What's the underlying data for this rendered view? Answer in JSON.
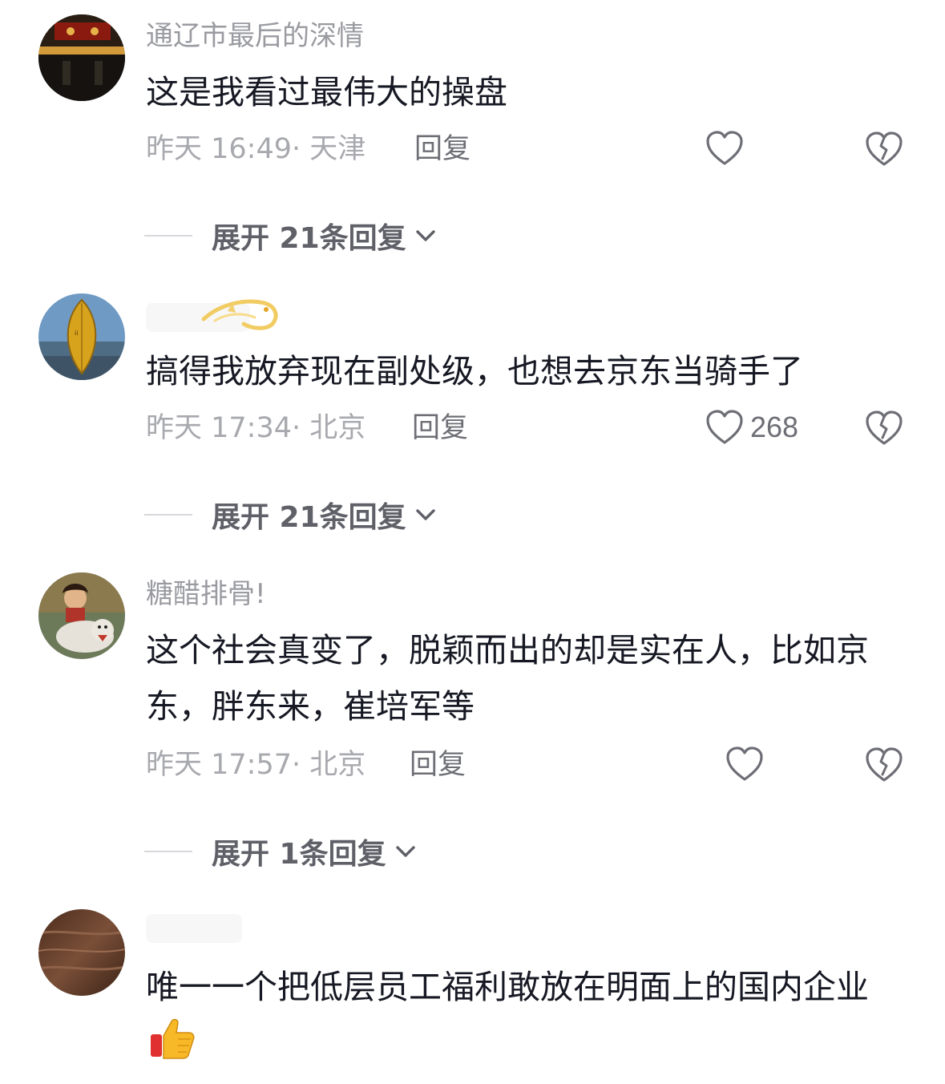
{
  "comments": [
    {
      "username": "通辽市最后的深情",
      "text": "这是我看过最伟大的操盘",
      "time": "昨天 16:49",
      "location": "天津",
      "reply_label": "回复",
      "like_count": "",
      "expand_label": "展开 21条回复",
      "avatar_icon": "storefront-night-avatar"
    },
    {
      "username": "",
      "text": "搞得我放弃现在副处级，也想去京东当骑手了",
      "time": "昨天 17:34",
      "location": "北京",
      "reply_label": "回复",
      "like_count": "268",
      "expand_label": "展开 21条回复",
      "avatar_icon": "golden-leaf-avatar",
      "badge_icon": "golden-dragon-icon"
    },
    {
      "username": "糖醋排骨!",
      "text": "这个社会真变了，脱颖而出的却是实在人，比如京东，胖东来，崔培军等",
      "time": "昨天 17:57",
      "location": "北京",
      "reply_label": "回复",
      "like_count": "",
      "expand_label": "展开 1条回复",
      "avatar_icon": "girl-riding-tiger-avatar"
    },
    {
      "username": "",
      "text": "唯一一个把低层员工福利敢放在明面上的国内企业",
      "time": "",
      "location": "",
      "reply_label": "",
      "like_count": "",
      "expand_label": "",
      "avatar_icon": "wood-grain-avatar",
      "emoji_icon": "thumbs-up-icon"
    }
  ],
  "colors": {
    "username": "#9a9ba1",
    "content": "#161823",
    "meta": "#a8a9ae",
    "action": "#6e6f76",
    "expand": "#5f6068"
  },
  "icons": {
    "like": "heart-outline-icon",
    "dislike": "broken-heart-icon",
    "expand": "chevron-down-icon"
  }
}
